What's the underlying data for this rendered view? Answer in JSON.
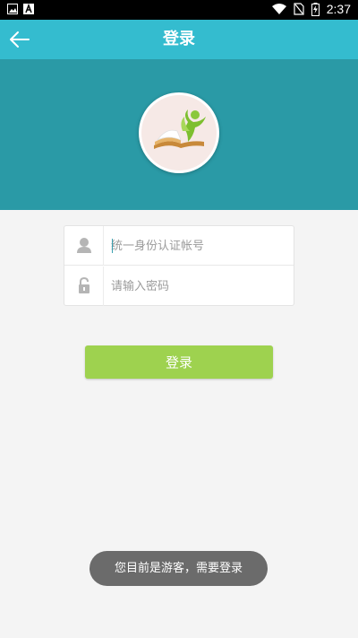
{
  "status_bar": {
    "time": "2:37",
    "left_icons": [
      "gallery-icon",
      "app-icon"
    ],
    "right_icons": [
      "wifi-icon",
      "no-sim-icon",
      "battery-charging-icon"
    ]
  },
  "header": {
    "title": "登录",
    "back_icon": "arrow-left-icon",
    "background": "#34bccf"
  },
  "hero": {
    "background": "#2a9aa6",
    "logo_icon": "book-person-logo"
  },
  "form": {
    "username_placeholder": "统一身份认证帐号",
    "password_placeholder": "请输入密码",
    "username_icon": "user-icon",
    "password_icon": "lock-icon"
  },
  "actions": {
    "login_label": "登录",
    "login_color": "#9ed24f"
  },
  "toast": {
    "message": "您目前是游客，需要登录"
  }
}
